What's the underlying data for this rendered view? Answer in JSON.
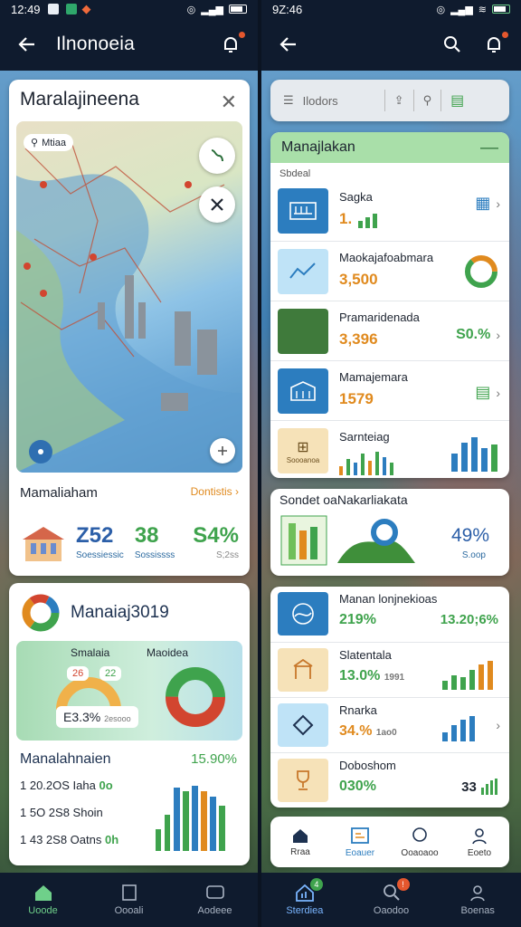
{
  "left": {
    "status": {
      "time": "12:49"
    },
    "header": {
      "title": "Ilnonoeia"
    },
    "map_card": {
      "title": "Maralajineena",
      "chip": "Mtiaa",
      "footer_title": "Mamaliaham",
      "footer_link": "Dontistis",
      "stats": [
        {
          "value": "Z52",
          "sub": "Soessiessic",
          "color": "#2c5fa8"
        },
        {
          "value": "38",
          "sub": "Sossissss",
          "color": "#3fa34d"
        },
        {
          "value": "S4%",
          "sub": "S;2ss",
          "color": "#3fa34d"
        }
      ]
    },
    "donut_card": {
      "title": "Manaiaj3019",
      "panel_label_1": "Smalaia",
      "panel_label_2": "Maoidea",
      "pill_1": "26",
      "pill_2": "22",
      "pill_big": "E3.3%",
      "pill_big_sub": "2esooo",
      "section_title": "Manalahnaien",
      "section_pct": "15.90%",
      "rows": [
        {
          "text": "1 20.2OS Iaha",
          "accent": "0o"
        },
        {
          "text": "1 5O 2S8 Shoin",
          "accent": ""
        },
        {
          "text": "1 43 2S8 Oatns",
          "accent": "0h"
        }
      ]
    },
    "nav": [
      {
        "label": "Uoode",
        "icon": "home-icon"
      },
      {
        "label": "Oooali",
        "icon": "document-icon"
      },
      {
        "label": "Aodeee",
        "icon": "message-icon"
      }
    ]
  },
  "right": {
    "status": {
      "time": "9Z:46"
    },
    "toolbar": {
      "placeholder": "Ilodors"
    },
    "list_card": {
      "title": "Manajlakan",
      "subtitle": "Sbdeal",
      "rows": [
        {
          "title": "Sagka",
          "value": "1.",
          "value_color": "orange",
          "right": "chart"
        },
        {
          "title": "Maokajafoabmara",
          "value": "3,500",
          "value_color": "orange",
          "right": "ring"
        },
        {
          "title": "Pramaridenada",
          "value": "3,396",
          "value_color": "orange",
          "right": "pct",
          "pct": "S0.%"
        },
        {
          "title": "Mamajemara",
          "value": "1579",
          "value_color": "orange",
          "right": "doc"
        },
        {
          "title": "Sarnteiag",
          "value": "",
          "value_color": "orange",
          "right": "bars",
          "icon_label": "Soooanoa"
        }
      ]
    },
    "wide_card": {
      "title": "Sondet oaNakarliakata",
      "pct": "49%",
      "sub": "S.oop"
    },
    "list2": [
      {
        "title": "Manan lonjnekioas",
        "value": "219%",
        "right": "13.20;6%"
      },
      {
        "title": "Slatentala",
        "value": "13.0%",
        "right": "",
        "small": "1991"
      },
      {
        "title": "Rnarka",
        "value": "34.%",
        "right": "",
        "small": "1ao0",
        "orange": true
      },
      {
        "title": "Doboshom",
        "value": "030%",
        "right": "33"
      }
    ],
    "inner_nav": [
      {
        "label": "Rraa",
        "icon": "home-icon"
      },
      {
        "label": "Eoauer",
        "icon": "report-icon"
      },
      {
        "label": "Ooaoaoo",
        "icon": "chat-icon"
      },
      {
        "label": "Eoeto",
        "icon": "user-icon"
      }
    ],
    "nav": [
      {
        "label": "Sterdiea",
        "icon": "chart-home-icon"
      },
      {
        "label": "Oaodoo",
        "icon": "search-icon"
      },
      {
        "label": "Boenas",
        "icon": "person-icon"
      }
    ]
  },
  "colors": {
    "accent_green": "#3fa34d",
    "accent_orange": "#e08a1e",
    "accent_blue": "#2c5fa8",
    "nav_bg": "#0f1b2e"
  }
}
